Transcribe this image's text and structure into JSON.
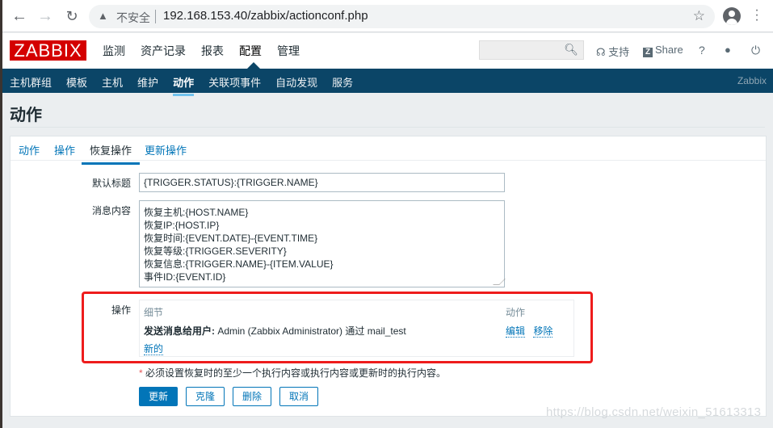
{
  "browser": {
    "back_icon": "arrow-left-icon",
    "forward_icon": "arrow-right-icon",
    "reload_icon": "reload-icon",
    "security_label": "不安全",
    "url": "192.168.153.40/zabbix/actionconf.php",
    "back_glyph": "←",
    "forward_glyph": "→",
    "reload_glyph": "↻",
    "warn_glyph": "▲",
    "star_glyph": "☆",
    "menu_glyph": "⋮"
  },
  "header": {
    "logo": "ZABBIX",
    "main_menu": [
      {
        "label": "监测",
        "active": false
      },
      {
        "label": "资产记录",
        "active": false
      },
      {
        "label": "报表",
        "active": false
      },
      {
        "label": "配置",
        "active": true
      },
      {
        "label": "管理",
        "active": false
      }
    ],
    "search_placeholder": "",
    "search_glyph": "⚲",
    "support_label": "支持",
    "support_glyph": "☊",
    "share_label": "Share",
    "share_badge": "Z",
    "help_glyph": "?",
    "user_glyph": "●",
    "logout_glyph": "⏻"
  },
  "submenu": {
    "items": [
      {
        "label": "主机群组",
        "active": false
      },
      {
        "label": "模板",
        "active": false
      },
      {
        "label": "主机",
        "active": false
      },
      {
        "label": "维护",
        "active": false
      },
      {
        "label": "动作",
        "active": true
      },
      {
        "label": "关联项事件",
        "active": false
      },
      {
        "label": "自动发现",
        "active": false
      },
      {
        "label": "服务",
        "active": false
      }
    ],
    "brand": "Zabbix"
  },
  "page": {
    "title": "动作",
    "tabs": [
      {
        "label": "动作",
        "active": false
      },
      {
        "label": "操作",
        "active": false
      },
      {
        "label": "恢复操作",
        "active": true
      },
      {
        "label": "更新操作",
        "active": false
      }
    ],
    "form": {
      "subject_label": "默认标题",
      "subject_value": "{TRIGGER.STATUS}:{TRIGGER.NAME}",
      "message_label": "消息内容",
      "message_lines": [
        "恢复主机:{HOST.NAME}",
        "恢复IP:{HOST.IP}",
        "恢复时间:{EVENT.DATE}-{EVENT.TIME}",
        "恢复等级:{TRIGGER.SEVERITY}",
        "恢复信息:{TRIGGER.NAME}-{ITEM.VALUE}",
        "事件ID:{EVENT.ID}"
      ],
      "operations_label": "操作",
      "operations": {
        "col_details": "细节",
        "col_actions": "动作",
        "rows": [
          {
            "detail_bold": "发送消息给用户:",
            "detail_text": " Admin (Zabbix Administrator) 通过 mail_test",
            "edit": "编辑",
            "remove": "移除"
          }
        ],
        "new_link": "新的"
      },
      "note_star": "*",
      "note": " 必须设置恢复时的至少一个执行内容或执行内容或更新时的执行内容。",
      "buttons": {
        "update": "更新",
        "clone": "克隆",
        "delete": "删除",
        "cancel": "取消"
      }
    }
  },
  "colors": {
    "brand_red": "#d40000",
    "nav_blue": "#0b4567",
    "link_blue": "#0275b8",
    "highlight_red": "#ee1c1c"
  },
  "watermark": "https://blog.csdn.net/weixin_51613313"
}
